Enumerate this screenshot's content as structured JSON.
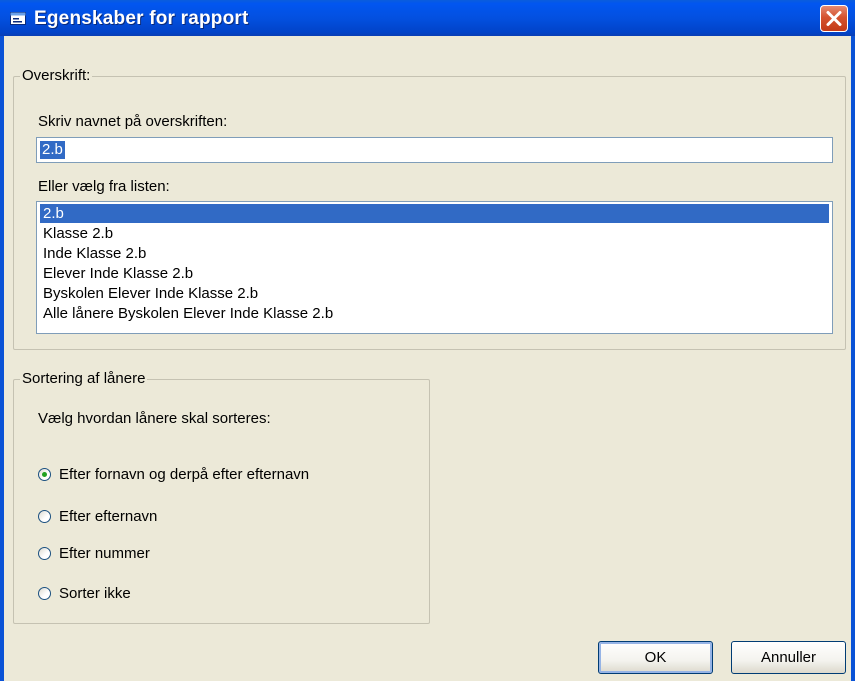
{
  "window": {
    "title": "Egenskaber for rapport",
    "title_icon": "window-app-icon",
    "close_icon": "close-icon"
  },
  "heading_group": {
    "legend": "Overskrift:",
    "name_label": "Skriv navnet på overskriften:",
    "name_value": "2.b",
    "list_label": "Eller vælg fra listen:",
    "list_items": [
      "2.b",
      "Klasse 2.b",
      "Inde Klasse 2.b",
      "Elever Inde Klasse 2.b",
      "Byskolen Elever Inde Klasse 2.b",
      "Alle lånere Byskolen Elever Inde Klasse 2.b"
    ],
    "selected_index": 0
  },
  "sort_group": {
    "legend": "Sortering af lånere",
    "prompt": "Vælg hvordan lånere skal sorteres:",
    "options": [
      "Efter fornavn og derpå efter efternavn",
      "Efter efternavn",
      "Efter nummer",
      "Sorter ikke"
    ],
    "selected_index": 0
  },
  "buttons": {
    "ok": "OK",
    "cancel": "Annuller"
  },
  "colors": {
    "titlebar": "#0350e0",
    "selection": "#316ac5",
    "dialog_bg": "#ece9d8",
    "close_button": "#d5532f"
  }
}
